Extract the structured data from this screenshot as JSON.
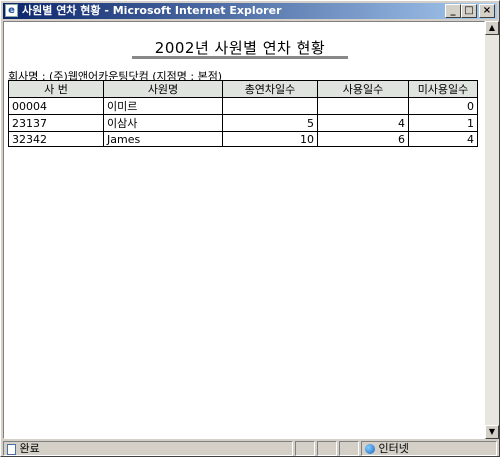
{
  "window": {
    "title": "사원별 연차 현황 - Microsoft Internet Explorer",
    "buttons": {
      "minimize": "_",
      "maximize": "□",
      "close": "×"
    }
  },
  "report": {
    "title": "2002년 사원별 연차 현황",
    "company_line": "회사명 : (주)웹앤어카운팅닷컴  (지점명 : 본점)"
  },
  "table": {
    "headers": [
      "사 번",
      "사원명",
      "총연차일수",
      "사용일수",
      "미사용일수"
    ],
    "rows": [
      [
        "00004",
        "이미르",
        "",
        "",
        "0"
      ],
      [
        "23137",
        "이삼사",
        "5",
        "4",
        "1"
      ],
      [
        "32342",
        "James",
        "10",
        "6",
        "4"
      ]
    ]
  },
  "status": {
    "left_text": "완료",
    "zone_text": "인터넷"
  },
  "icons": {
    "title_icon": "ie-page-icon",
    "status_icon": "ie-page-icon",
    "zone_icon": "globe-icon"
  }
}
